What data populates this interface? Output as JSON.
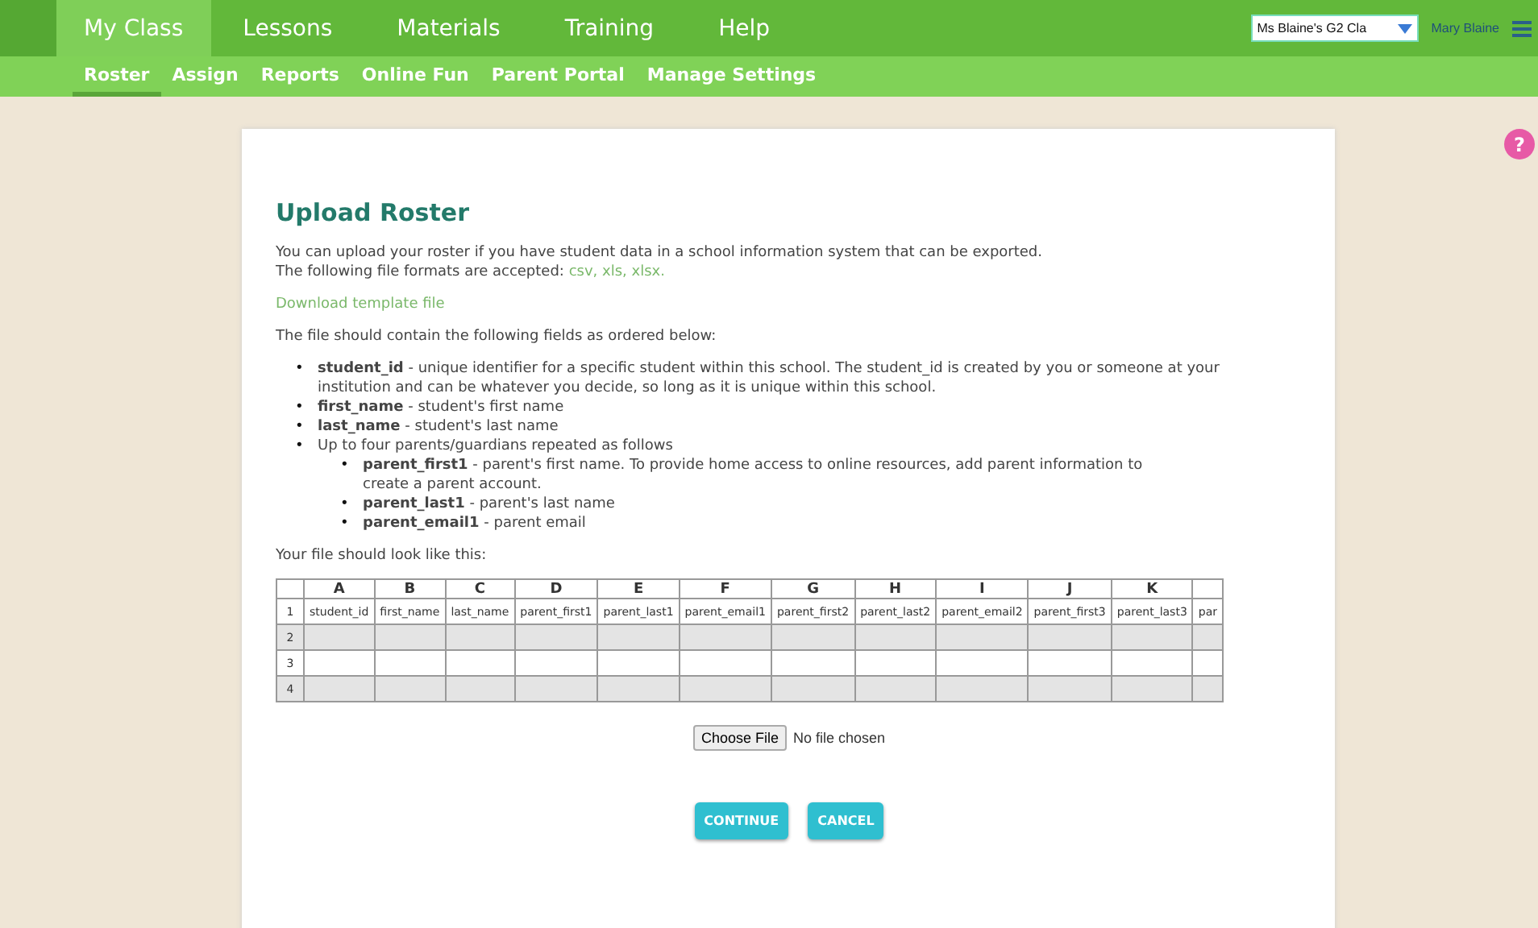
{
  "nav": {
    "tabs": [
      {
        "label": "My Class",
        "selected": true
      },
      {
        "label": "Lessons",
        "selected": false
      },
      {
        "label": "Materials",
        "selected": false
      },
      {
        "label": "Training",
        "selected": false
      },
      {
        "label": "Help",
        "selected": false
      }
    ],
    "subtabs": [
      {
        "label": "Roster",
        "selected": true
      },
      {
        "label": "Assign",
        "selected": false
      },
      {
        "label": "Reports",
        "selected": false
      },
      {
        "label": "Online Fun",
        "selected": false
      },
      {
        "label": "Parent Portal",
        "selected": false
      },
      {
        "label": "Manage Settings",
        "selected": false
      }
    ],
    "class_select": "Ms Blaine's G2 Cla",
    "user": "Mary Blaine"
  },
  "title": "Upload Roster",
  "intro": [
    "You can upload your roster if you have student data in a school information system that can be exported.",
    "The following file formats are accepted: "
  ],
  "formats": "csv, xls, xlsx.",
  "template_link": "Download template file",
  "fields_intro": "The file should contain the following fields as ordered below:",
  "fields": [
    {
      "bullet": "•",
      "text": "**student_id** - unique identifier for a specific student within this school. The student_id is created by you or someone at your institution and can be whatever you decide, so long as it is unique within this school."
    },
    {
      "bullet": "•",
      "text": "**first_name** - student's first name"
    },
    {
      "bullet": "•",
      "text": "**last_name** - student's last name"
    },
    {
      "bullet": "•",
      "text": "Up to four parents/guardians repeated as follows",
      "children": [
        {
          "bullet": "•",
          "text": "**parent_first1** - parent's first name. To provide home access to online resources, add parent information to create a parent account."
        },
        {
          "bullet": "•",
          "text": "**parent_last1** - parent's last name"
        },
        {
          "bullet": "•",
          "text": "**parent_email1** - parent email"
        }
      ]
    }
  ],
  "example_intro": "Your file should look like this:",
  "sheet": {
    "columns": [
      {
        "letter": "A",
        "field": "student_id"
      },
      {
        "letter": "B",
        "field": "first_name"
      },
      {
        "letter": "C",
        "field": "last_name"
      },
      {
        "letter": "D",
        "field": "parent_first1"
      },
      {
        "letter": "E",
        "field": "parent_last1"
      },
      {
        "letter": "F",
        "field": "parent_email1"
      },
      {
        "letter": "G",
        "field": "parent_first2"
      },
      {
        "letter": "H",
        "field": "parent_last2"
      },
      {
        "letter": "I",
        "field": "parent_email2"
      },
      {
        "letter": "J",
        "field": "parent_first3"
      },
      {
        "letter": "K",
        "field": "parent_last3"
      },
      {
        "field": "par"
      }
    ],
    "rows": [
      "1",
      "2",
      "3",
      "4"
    ]
  },
  "file": {
    "button": "Choose File",
    "status": "No file chosen"
  },
  "buttons": [
    "CONTINUE",
    "CANCEL"
  ],
  "help": "?"
}
